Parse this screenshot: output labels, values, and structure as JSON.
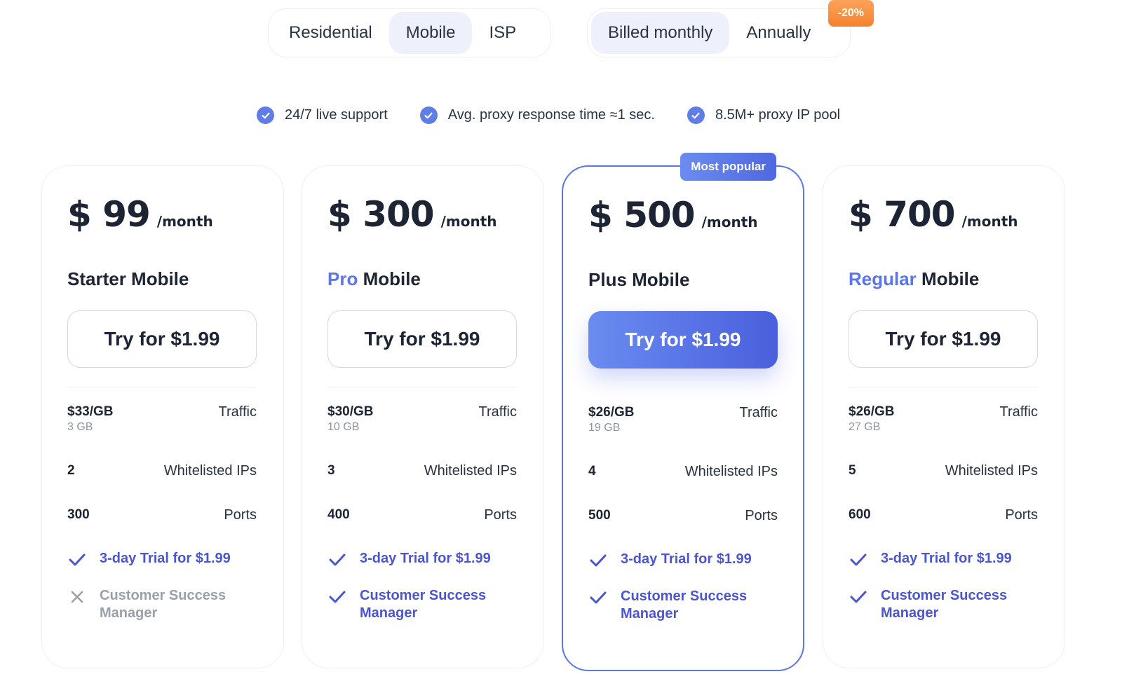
{
  "product_tabs": [
    {
      "label": "Residential",
      "active": false
    },
    {
      "label": "Mobile",
      "active": true
    },
    {
      "label": "ISP",
      "active": false
    }
  ],
  "billing_tabs": [
    {
      "label": "Billed monthly",
      "active": true
    },
    {
      "label": "Annually",
      "active": false
    }
  ],
  "discount_badge": "-20%",
  "features": [
    "24/7 live support",
    "Avg. proxy response time ≈1 sec.",
    "8.5M+ proxy IP pool"
  ],
  "popular_badge": "Most popular",
  "colors": {
    "accent": "#5b76ec",
    "link": "#4a55cf",
    "discount": "#f4822c"
  },
  "plans": [
    {
      "price": "$ 99",
      "period": "/month",
      "name_highlight": "",
      "name_rest": "Starter Mobile",
      "cta": "Try for $1.99",
      "traffic_price": "$33/GB",
      "traffic_amount": "3 GB",
      "traffic_label": "Traffic",
      "ips": "2",
      "ips_label": "Whitelisted IPs",
      "ports": "300",
      "ports_label": "Ports",
      "perk_trial": "3-day Trial for $1.99",
      "perk_manager": "Customer Success Manager"
    },
    {
      "price": "$ 300",
      "period": "/month",
      "name_highlight": "Pro",
      "name_rest": " Mobile",
      "cta": "Try for $1.99",
      "traffic_price": "$30/GB",
      "traffic_amount": "10 GB",
      "traffic_label": "Traffic",
      "ips": "3",
      "ips_label": "Whitelisted IPs",
      "ports": "400",
      "ports_label": "Ports",
      "perk_trial": "3-day Trial for $1.99",
      "perk_manager": "Customer Success Manager"
    },
    {
      "price": "$ 500",
      "period": "/month",
      "name_highlight": "",
      "name_rest": "Plus Mobile",
      "cta": "Try for $1.99",
      "traffic_price": "$26/GB",
      "traffic_amount": "19 GB",
      "traffic_label": "Traffic",
      "ips": "4",
      "ips_label": "Whitelisted IPs",
      "ports": "500",
      "ports_label": "Ports",
      "perk_trial": "3-day Trial for $1.99",
      "perk_manager": "Customer Success Manager"
    },
    {
      "price": "$ 700",
      "period": "/month",
      "name_highlight": "Regular",
      "name_rest": " Mobile",
      "cta": "Try for $1.99",
      "traffic_price": "$26/GB",
      "traffic_amount": "27 GB",
      "traffic_label": "Traffic",
      "ips": "5",
      "ips_label": "Whitelisted IPs",
      "ports": "600",
      "ports_label": "Ports",
      "perk_trial": "3-day Trial for $1.99",
      "perk_manager": "Customer Success Manager"
    }
  ]
}
